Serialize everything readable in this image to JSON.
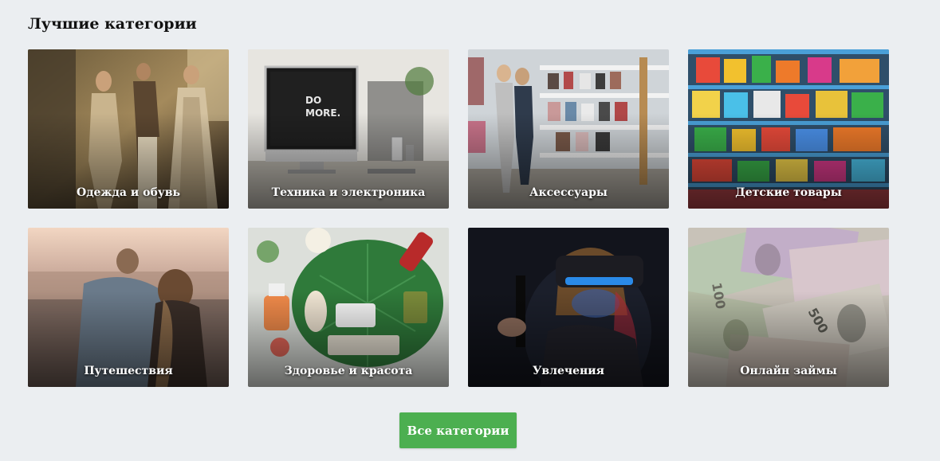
{
  "section": {
    "title": "Лучшие категории"
  },
  "categories": [
    {
      "label": "Одежда и обувь",
      "image": "fashion-photo"
    },
    {
      "label": "Техника и электроника",
      "image": "electronics-photo"
    },
    {
      "label": "Аксессуары",
      "image": "accessories-photo"
    },
    {
      "label": "Детские товары",
      "image": "kids-goods-photo"
    },
    {
      "label": "Путешествия",
      "image": "travel-photo"
    },
    {
      "label": "Здоровье и красота",
      "image": "health-beauty-photo"
    },
    {
      "label": "Увлечения",
      "image": "hobbies-photo"
    },
    {
      "label": "Онлайн займы",
      "image": "online-loans-photo"
    }
  ],
  "button": {
    "label": "Все категории",
    "color": "#4caf50"
  }
}
